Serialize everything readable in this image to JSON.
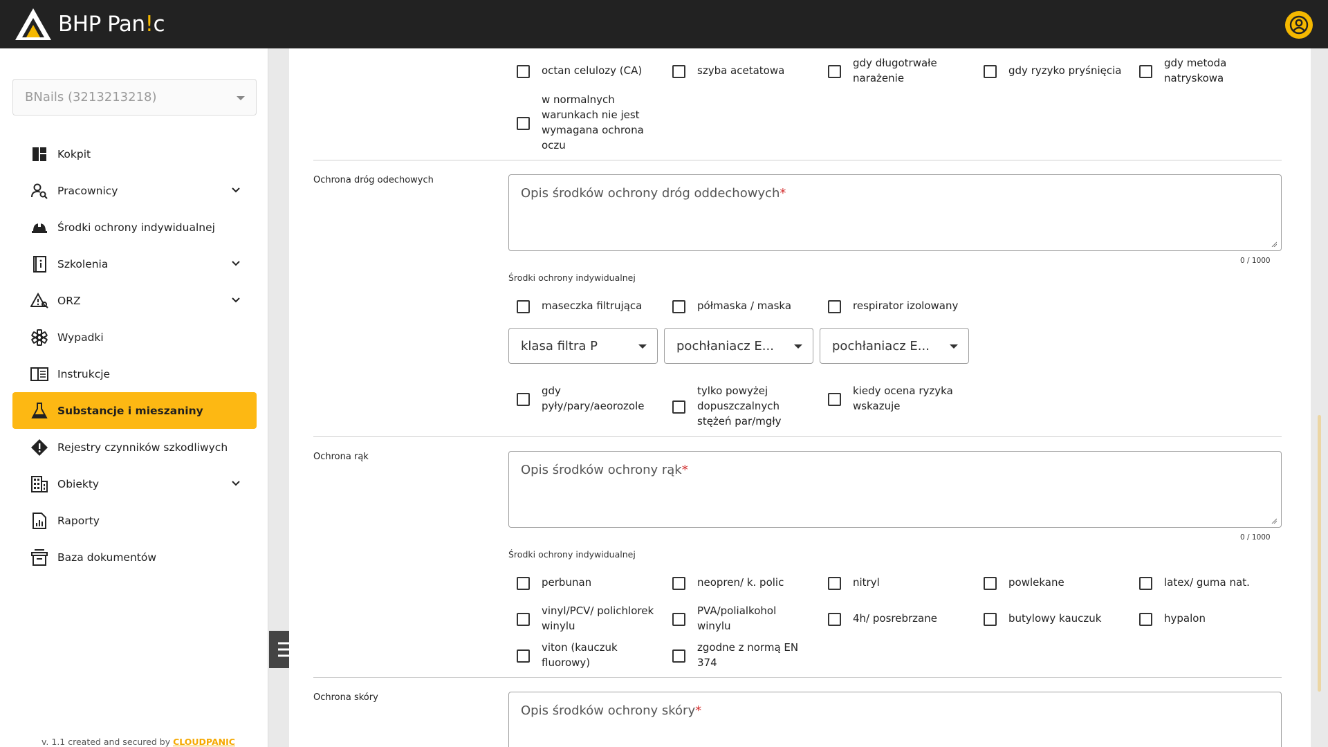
{
  "app": {
    "name_part1": "BHP Pan",
    "name_accent": "!",
    "name_part2": "c"
  },
  "company_select": {
    "value": "BNails (3213213218)"
  },
  "sidebar": {
    "items": [
      {
        "label": "Kokpit"
      },
      {
        "label": "Pracownicy"
      },
      {
        "label": "Środki ochrony indywidualnej"
      },
      {
        "label": "Szkolenia"
      },
      {
        "label": "ORZ"
      },
      {
        "label": "Wypadki"
      },
      {
        "label": "Instrukcje"
      },
      {
        "label": "Substancje i mieszaniny"
      },
      {
        "label": "Rejestry czynników szkodliwych"
      },
      {
        "label": "Obiekty"
      },
      {
        "label": "Raporty"
      },
      {
        "label": "Baza dokumentów"
      }
    ],
    "footer_text": "v. 1.1 created and secured by ",
    "footer_brand": "CLOUDPANIC"
  },
  "eye_section": {
    "options": [
      {
        "label": "octan celulozy (CA)"
      },
      {
        "label": "szyba acetatowa"
      },
      {
        "label": "gdy długotrwałe narażenie"
      },
      {
        "label": "gdy ryzyko pryśnięcia"
      },
      {
        "label": "gdy metoda natryskowa"
      },
      {
        "label": "w normalnych warunkach nie jest wymagana ochrona oczu"
      }
    ]
  },
  "respiratory": {
    "title": "Ochrona dróg odechowych",
    "textarea_placeholder": "Opis środków ochrony dróg oddechowych",
    "required_mark": "*",
    "counter": "0 / 1000",
    "ppe_label": "Środki ochrony indywidualnej",
    "options": [
      {
        "label": "maseczka filtrująca"
      },
      {
        "label": "półmaska / maska"
      },
      {
        "label": "respirator izolowany"
      }
    ],
    "selects": [
      {
        "value": "klasa filtra P"
      },
      {
        "value": "pochłaniacz E..."
      },
      {
        "value": "pochłaniacz E..."
      }
    ],
    "conditions": [
      {
        "label": "gdy pyły/pary/aeorozole"
      },
      {
        "label": "tylko powyżej dopuszczalnych stężeń par/mgły"
      },
      {
        "label": "kiedy ocena ryzyka wskazuje"
      }
    ]
  },
  "hands": {
    "title": "Ochrona rąk",
    "textarea_placeholder": "Opis środków ochrony rąk",
    "required_mark": "*",
    "counter": "0 / 1000",
    "ppe_label": "Środki ochrony indywidualnej",
    "options": [
      {
        "label": "perbunan"
      },
      {
        "label": "neopren/ k. polic"
      },
      {
        "label": "nitryl"
      },
      {
        "label": "powlekane"
      },
      {
        "label": "latex/ guma nat."
      },
      {
        "label": "vinyl/PCV/ polichlorek winylu"
      },
      {
        "label": "PVA/polialkohol winylu"
      },
      {
        "label": "4h/ posrebrzane"
      },
      {
        "label": "butylowy kauczuk"
      },
      {
        "label": "hypalon"
      },
      {
        "label": "viton (kauczuk fluorowy)"
      },
      {
        "label": "zgodne z normą EN 374"
      }
    ]
  },
  "skin": {
    "title": "Ochrona skóry",
    "textarea_placeholder": "Opis środków ochrony skóry",
    "required_mark": "*"
  },
  "colors": {
    "accent": "#fdb813",
    "topbar": "#222222",
    "required": "#d32f2f"
  }
}
